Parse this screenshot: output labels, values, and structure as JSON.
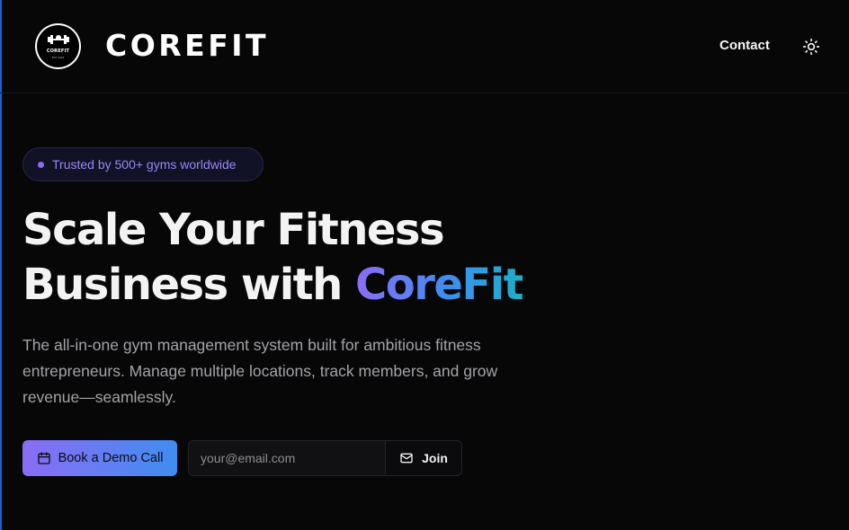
{
  "header": {
    "logo_text": "COREFIT",
    "logo_sub": "EST 2023",
    "brand": "COREFIT",
    "nav": {
      "contact": "Contact"
    },
    "theme_icon": "sun-icon"
  },
  "hero": {
    "badge": "Trusted by 500+ gyms worldwide",
    "headline_line1": "Scale Your Fitness",
    "headline_line2_prefix": "Business with ",
    "headline_accent": "CoreFit",
    "description": "The all-in-one gym management system built for ambitious fitness entrepreneurs. Manage multiple locations, track members, and grow revenue—seamlessly.",
    "demo_button": {
      "label": "Book a Demo Call",
      "icon": "calendar-icon"
    },
    "email": {
      "placeholder": "your@email.com",
      "value": ""
    },
    "join_button": {
      "label": "Join",
      "icon": "mail-icon"
    }
  },
  "colors": {
    "background": "#070708",
    "accent_purple": "#8b6cf5",
    "accent_blue": "#3f8df0",
    "accent_teal": "#1bb0c8",
    "badge_text": "#9b87f5",
    "body_text": "#a3a3a8"
  }
}
